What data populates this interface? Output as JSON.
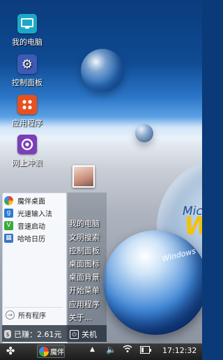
{
  "desktop": {
    "icons": [
      {
        "label": "我的电脑",
        "icon": "monitor-icon"
      },
      {
        "label": "控制面板",
        "icon": "gear-icon"
      },
      {
        "label": "应用程序",
        "icon": "apps-grid-icon"
      },
      {
        "label": "网上冲浪",
        "icon": "browser-icon"
      }
    ],
    "wallpaper": {
      "text_line1": "Mic",
      "text_big": "W",
      "ball_text": "Windows"
    }
  },
  "start_menu": {
    "apps": [
      {
        "label": "魔伴桌面",
        "icon": "mobo-icon"
      },
      {
        "label": "光速输入法",
        "icon": "keyboard-icon"
      },
      {
        "label": "音速启动",
        "icon": "launch-icon"
      },
      {
        "label": "哈哈日历",
        "icon": "calendar-icon"
      }
    ],
    "all_programs": "所有程序",
    "system_items": [
      "我的电脑",
      "文明搜索",
      "控制面板",
      "桌面图标",
      "桌面背景",
      "开始菜单",
      "应用程序",
      "关于..."
    ],
    "earned": "已赚：2.61元",
    "shutdown": "关机"
  },
  "taskbar": {
    "start_icon": "clover-icon",
    "running_app": "魔伴",
    "clock": "17:12:32",
    "battery_level": 0.25
  },
  "colors": {
    "taskbar": "#1c1c1c",
    "menu_left": "#f8fafd",
    "accent_blue": "#0b3c7d"
  }
}
